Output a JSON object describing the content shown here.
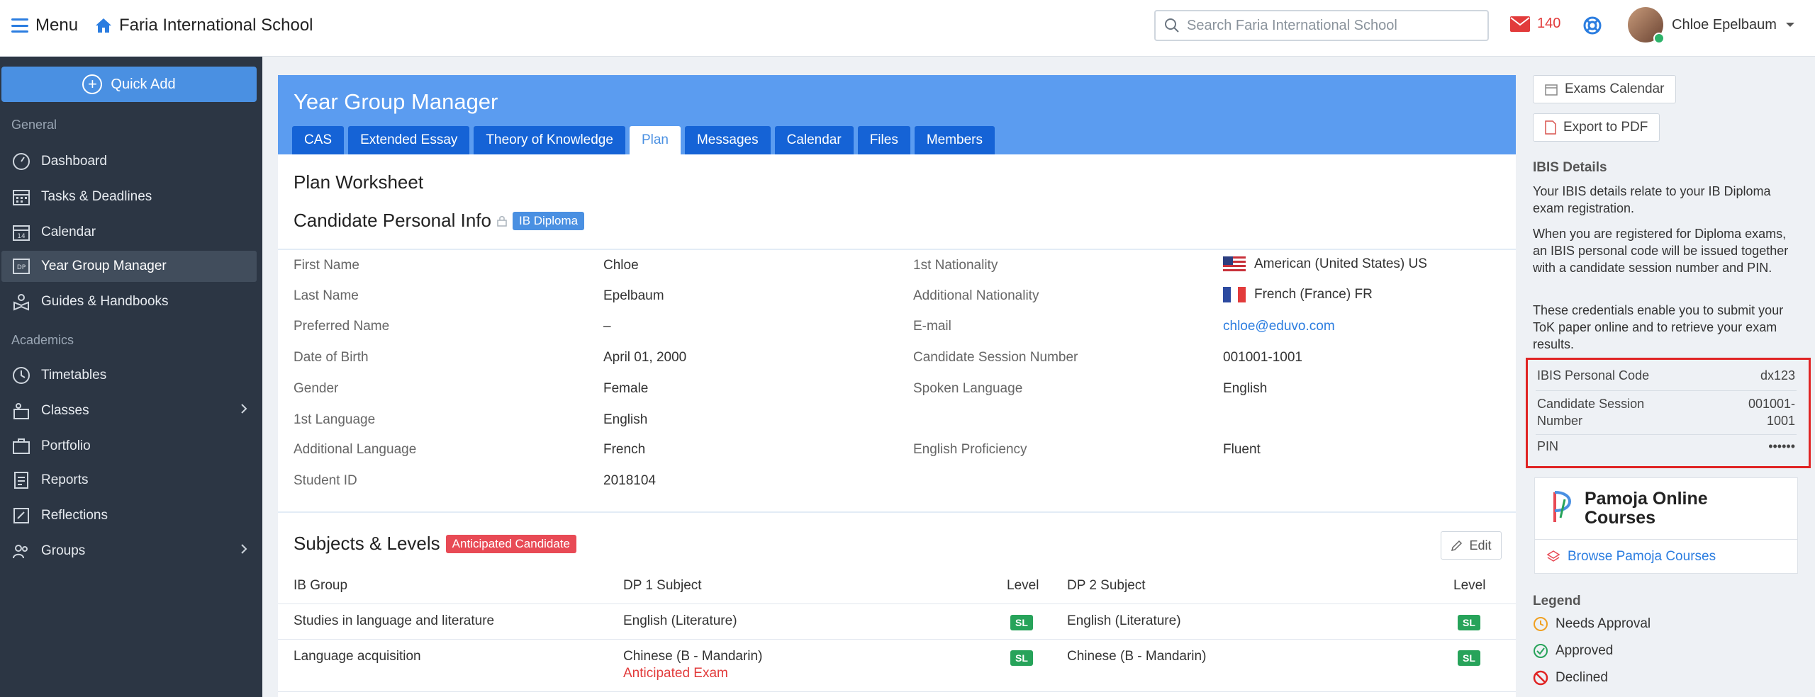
{
  "topbar": {
    "menu_label": "Menu",
    "school_name": "Faria International School",
    "search_placeholder": "Search Faria International School",
    "mail_count": "140",
    "user_name": "Chloe Epelbaum"
  },
  "sidebar": {
    "quick_add": "Quick Add",
    "section_general": "General",
    "section_academics": "Academics",
    "items": [
      {
        "label": "Dashboard",
        "icon": "dashboard-icon"
      },
      {
        "label": "Tasks & Deadlines",
        "icon": "tasks-icon"
      },
      {
        "label": "Calendar",
        "icon": "calendar-icon",
        "icon_text": "14"
      },
      {
        "label": "Year Group Manager",
        "icon": "dp-icon",
        "icon_text": "DP"
      },
      {
        "label": "Guides & Handbooks",
        "icon": "guides-icon"
      },
      {
        "label": "Timetables",
        "icon": "clock-icon"
      },
      {
        "label": "Classes",
        "icon": "classes-icon"
      },
      {
        "label": "Portfolio",
        "icon": "portfolio-icon"
      },
      {
        "label": "Reports",
        "icon": "reports-icon"
      },
      {
        "label": "Reflections",
        "icon": "reflections-icon"
      },
      {
        "label": "Groups",
        "icon": "groups-icon"
      }
    ]
  },
  "main": {
    "title": "Year Group Manager",
    "tabs": [
      "CAS",
      "Extended Essay",
      "Theory of Knowledge",
      "Plan",
      "Messages",
      "Calendar",
      "Files",
      "Members"
    ],
    "worksheet_title": "Plan Worksheet",
    "personal_title": "Candidate Personal Info",
    "personal_badge": "IB Diploma",
    "left_info": [
      {
        "label": "First Name",
        "value": "Chloe"
      },
      {
        "label": "Last Name",
        "value": "Epelbaum"
      },
      {
        "label": "Preferred Name",
        "value": "–"
      },
      {
        "label": "Date of Birth",
        "value": "April 01, 2000"
      },
      {
        "label": "Gender",
        "value": "Female"
      },
      {
        "label": "1st Language",
        "value": "English"
      },
      {
        "label": "Additional Language",
        "value": "French"
      },
      {
        "label": "Student ID",
        "value": "2018104"
      }
    ],
    "right_info": [
      {
        "label": "1st Nationality",
        "value": "American (United States) US"
      },
      {
        "label": "Additional Nationality",
        "value": "French (France) FR"
      },
      {
        "label": "E-mail",
        "value": "chloe@eduvo.com"
      },
      {
        "label": "Candidate Session Number",
        "value": "001001-1001"
      },
      {
        "label": "Spoken Language",
        "value": "English"
      },
      {
        "label": "English Proficiency",
        "value": "Fluent"
      }
    ],
    "subjects_title": "Subjects & Levels",
    "subjects_badge": "Anticipated Candidate",
    "edit_label": "Edit",
    "table_headers": [
      "IB Group",
      "DP 1 Subject",
      "Level",
      "DP 2 Subject",
      "Level"
    ],
    "rows": [
      {
        "group": "Studies in language and literature",
        "dp1": "English (Literature)",
        "dp1_level": "SL",
        "dp1_note": "",
        "dp2": "English (Literature)",
        "dp2_level": "SL"
      },
      {
        "group": "Language acquisition",
        "dp1": "Chinese (B - Mandarin)",
        "dp1_level": "SL",
        "dp1_note": "Anticipated Exam",
        "dp2": "Chinese (B - Mandarin)",
        "dp2_level": "SL"
      }
    ]
  },
  "right": {
    "exams_calendar": "Exams Calendar",
    "export_pdf": "Export to PDF",
    "ibis_heading": "IBIS Details",
    "ibis_p1": "Your IBIS details relate to your IB Diploma exam registration.",
    "ibis_p2": "When you are registered for Diploma exams, an IBIS personal code will be issued together with a candidate session number and PIN.",
    "ibis_p3": "These credentials enable you to submit your ToK paper online and to retrieve your exam results.",
    "ibis_rows": [
      {
        "label": "IBIS Personal Code",
        "value": "dx123"
      },
      {
        "label": "Candidate Session Number",
        "value": "001001-1001"
      },
      {
        "label": "PIN",
        "value": "••••••"
      }
    ],
    "pamoja_title": "Pamoja Online Courses",
    "pamoja_link": "Browse Pamoja Courses",
    "legend_heading": "Legend",
    "legend": [
      {
        "label": "Needs Approval",
        "color": "#f0a020"
      },
      {
        "label": "Approved",
        "color": "#27a35a"
      },
      {
        "label": "Declined",
        "color": "#e02424"
      }
    ]
  },
  "colors": {
    "accent": "#4a90e2",
    "header_blue": "#5b9cf0",
    "tab_blue": "#1563d6",
    "sidebar": "#2c3644",
    "highlight_red": "#e02424"
  }
}
